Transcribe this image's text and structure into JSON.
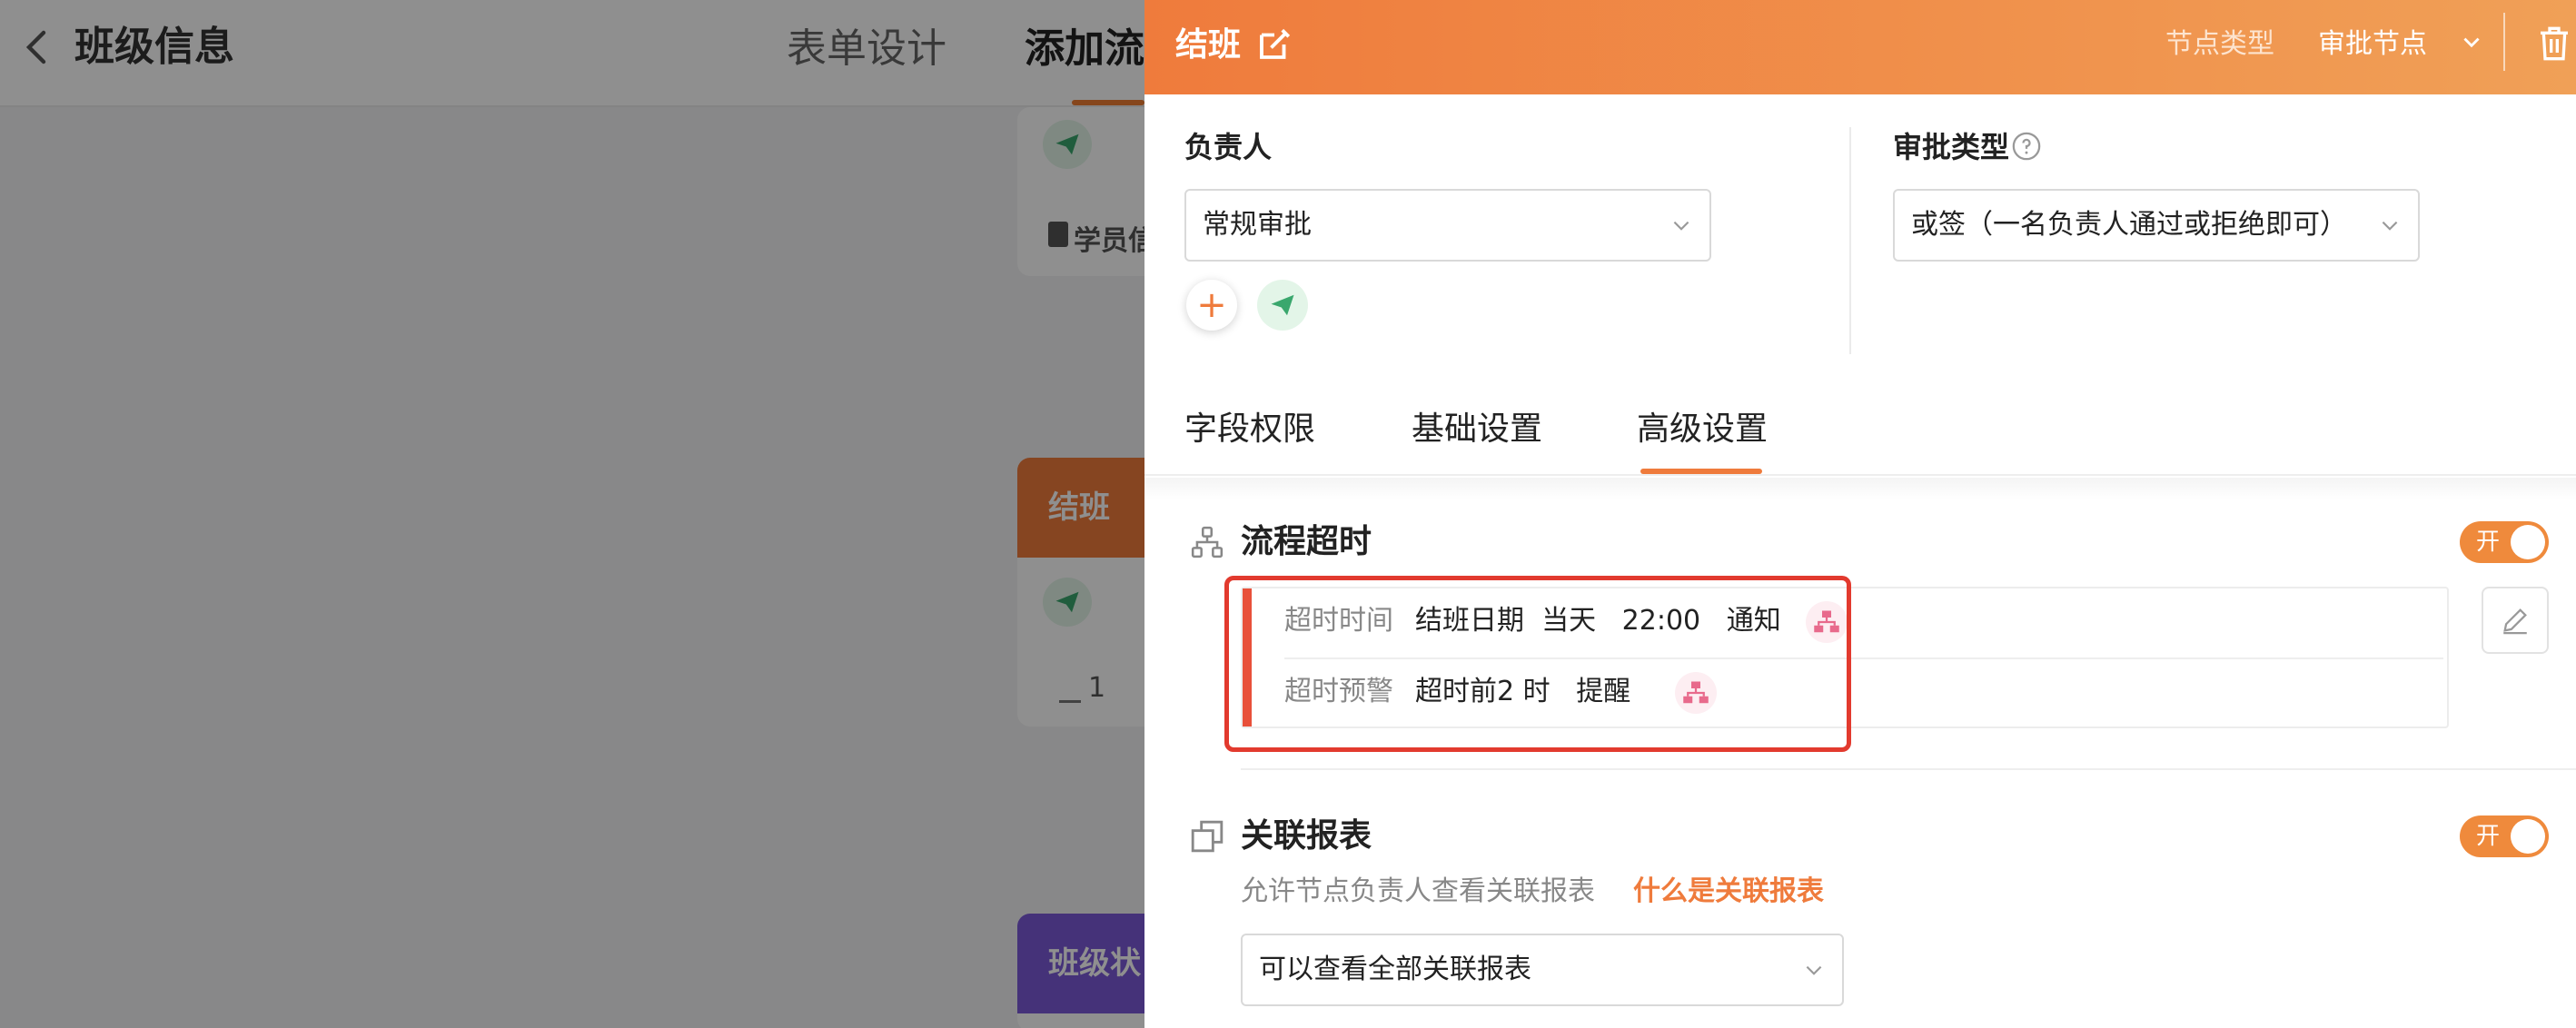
{
  "background": {
    "page_title": "班级信息",
    "tabs": [
      "表单设计",
      "添加流"
    ],
    "card1_text": "学员信",
    "card2_title": "结班",
    "card2_counter": "1",
    "card3_title": "班级状"
  },
  "drawer": {
    "title": "结班",
    "node_type_label": "节点类型",
    "node_type_value": "审批节点",
    "owner_label": "负责人",
    "owner_value": "常规审批",
    "approval_type_label": "审批类型",
    "approval_type_value": "或签（一名负责人通过或拒绝即可）",
    "tabs": [
      "字段权限",
      "基础设置",
      "高级设置"
    ],
    "active_tab": 2,
    "timeout_section": {
      "title": "流程超时",
      "toggle": "开",
      "rows": [
        {
          "label": "超时时间",
          "value": "结班日期  当天   22:00   通知"
        },
        {
          "label": "超时预警",
          "value": "超时前2 时   提醒"
        }
      ]
    },
    "report_section": {
      "title": "关联报表",
      "toggle": "开",
      "description": "允许节点负责人查看关联报表",
      "help_link": "什么是关联报表",
      "select_value": "可以查看全部关联报表"
    }
  },
  "colors": {
    "accent": "#ef7b3c",
    "highlight_border": "#e23a2e",
    "send_green": "#3aa76d"
  }
}
